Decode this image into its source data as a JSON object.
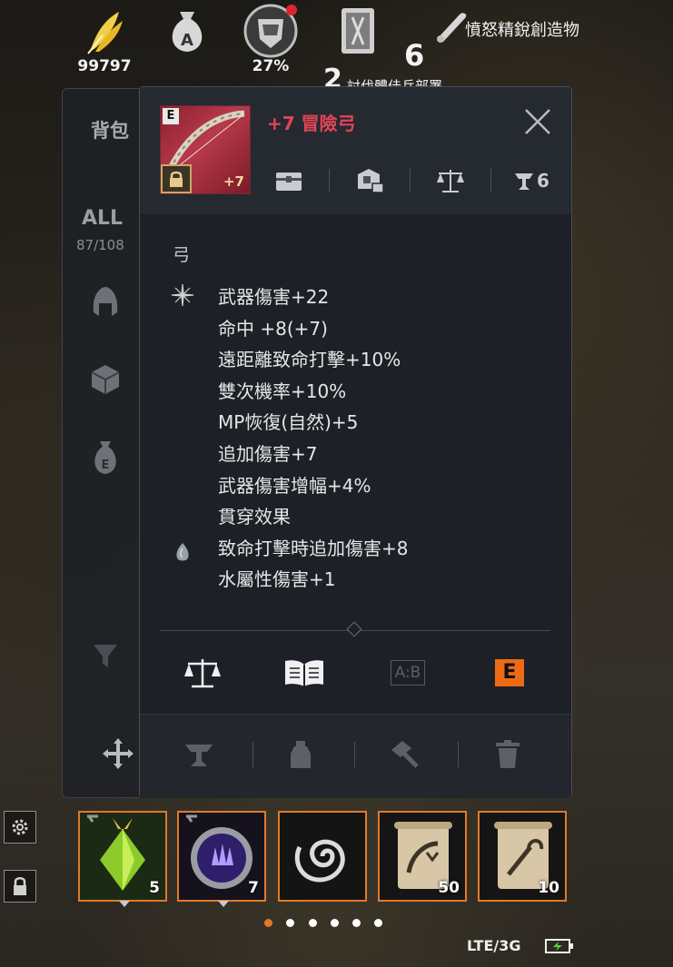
{
  "hud": {
    "gold_icon": "feather-gold-icon",
    "gold_value": "99797",
    "bag_icon": "money-bag-a-icon",
    "weight_icon": "armor-weight-icon",
    "weight_percent": "27%",
    "codex_icon": "codex-book-icon",
    "quest_icon": "scroll-quest-icon",
    "quest_number": "6",
    "quest_text": "憤怒精銳創造物",
    "quest_number_2": "2",
    "quest_text_2": "討伐體佳兵部署",
    "notification_color": "#e0242e"
  },
  "inventory": {
    "title": "背包",
    "filter_all": "ALL",
    "count": "87/108"
  },
  "item": {
    "grade": "E",
    "enhance": "+7",
    "name": "+7 冒險弓",
    "name_color": "#e34456",
    "category": "弓",
    "tool_badge_count": "6",
    "stats": [
      "武器傷害+22",
      "命中 +8(+7)",
      "遠距離致命打擊+10%",
      "雙次機率+10%",
      "MP恢復(自然)+5",
      "追加傷害+7",
      "武器傷害增幅+4%",
      "貫穿效果",
      "致命打擊時追加傷害+8",
      "水屬性傷害+1"
    ],
    "compare_label": "A:B",
    "grade_button": "E"
  },
  "quickslots": [
    {
      "icon": "green-potion-icon",
      "count": "5"
    },
    {
      "icon": "purple-orb-icon",
      "count": "7"
    },
    {
      "icon": "swirl-icon",
      "count": ""
    },
    {
      "icon": "teleport-scroll-icon",
      "count": "50"
    },
    {
      "icon": "return-scroll-icon",
      "count": "10"
    }
  ],
  "status": {
    "network": "LTE/3G"
  },
  "accent_color": "#e07a28"
}
